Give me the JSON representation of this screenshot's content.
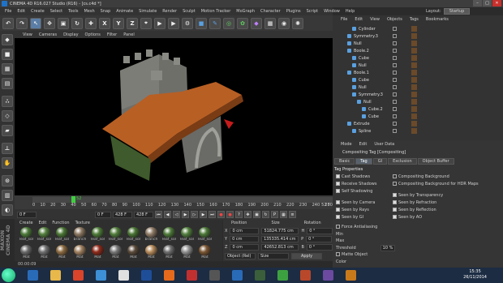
{
  "window": {
    "title": "CINEMA 4D R16.027 Studio (R16) - [cs.c4d *]"
  },
  "menu": [
    "File",
    "Edit",
    "Create",
    "Select",
    "Tools",
    "Mesh",
    "Snap",
    "Animate",
    "Simulate",
    "Render",
    "Sculpt",
    "Motion Tracker",
    "MoGraph",
    "Character",
    "Plugins",
    "Script",
    "Window",
    "Help"
  ],
  "layout": {
    "label": "Layout:",
    "value": "Startup"
  },
  "viewport_menu": [
    "View",
    "Cameras",
    "Display",
    "Options",
    "Filter",
    "Panel"
  ],
  "timeline": {
    "ticks": [
      "0",
      "10",
      "20",
      "30",
      "40",
      "50",
      "60",
      "70",
      "80",
      "90",
      "100",
      "110",
      "120",
      "130",
      "140",
      "150",
      "160",
      "170",
      "180",
      "190",
      "200",
      "210",
      "220",
      "230",
      "240",
      "250"
    ],
    "current_frame": "52",
    "end_label": "52 F"
  },
  "transport": {
    "start": "0 F",
    "current": "0 F",
    "end": "428 F",
    "end2": "428 F"
  },
  "materials": {
    "menu": [
      "Create",
      "Edit",
      "Function",
      "Texture"
    ],
    "items": [
      {
        "name": "leaf_sol",
        "color": "#4d7a3a"
      },
      {
        "name": "leaf_sol",
        "color": "#557f3f"
      },
      {
        "name": "leaf_sol",
        "color": "#4b7635"
      },
      {
        "name": "branch",
        "color": "#8a7660"
      },
      {
        "name": "leaf_sol",
        "color": "#4e7b39"
      },
      {
        "name": "leaf_sol",
        "color": "#527d3c"
      },
      {
        "name": "leaf_sol",
        "color": "#4a7434"
      },
      {
        "name": "branch",
        "color": "#8f7b66"
      },
      {
        "name": "leaf_sol",
        "color": "#4f7a3b"
      },
      {
        "name": "leaf_sol",
        "color": "#527f3e"
      },
      {
        "name": "leaf_sol",
        "color": "#4c7837"
      },
      {
        "name": "Mat",
        "color": "#6a6a6a"
      },
      {
        "name": "Mat",
        "color": "#707070"
      },
      {
        "name": "Mat",
        "color": "#8a6a40"
      },
      {
        "name": "Mat",
        "color": "#a08060"
      },
      {
        "name": "Mat",
        "color": "#8f2a1a"
      },
      {
        "name": "Mat",
        "color": "#777777"
      },
      {
        "name": "Mat",
        "color": "#5a4a3a"
      },
      {
        "name": "Mat",
        "color": "#b58a5a"
      },
      {
        "name": "Mat",
        "color": "#6d6d6d"
      },
      {
        "name": "Mat",
        "color": "#909090"
      },
      {
        "name": "Mat",
        "color": "#7a5533"
      }
    ]
  },
  "coordinates": {
    "headers": [
      "Position",
      "Size",
      "Rotation"
    ],
    "rows": [
      {
        "axis": "X",
        "pos": "0 cm",
        "size": "51824.775 cm",
        "rlabel": "H",
        "rot": "0 °"
      },
      {
        "axis": "Y",
        "pos": "0 cm",
        "size": "135335.414 cm",
        "rlabel": "P",
        "rot": "0 °"
      },
      {
        "axis": "Z",
        "pos": "0 cm",
        "size": "42652.813 cm",
        "rlabel": "B",
        "rot": "0 °"
      }
    ],
    "mode": "Object (Rel)",
    "size_mode": "Size",
    "apply": "Apply"
  },
  "status": "00:00:09",
  "object_manager": {
    "menu": [
      "File",
      "Edit",
      "View",
      "Objects",
      "Tags",
      "Bookmarks"
    ],
    "items": [
      {
        "name": "Cylinder",
        "indent": 2
      },
      {
        "name": "Symmetry.3",
        "indent": 1
      },
      {
        "name": "Null",
        "indent": 1
      },
      {
        "name": "Boole.2",
        "indent": 1
      },
      {
        "name": "Cube",
        "indent": 2
      },
      {
        "name": "Null",
        "indent": 2
      },
      {
        "name": "Boole.1",
        "indent": 1
      },
      {
        "name": "Cube",
        "indent": 2
      },
      {
        "name": "Null",
        "indent": 2
      },
      {
        "name": "Symmetry.3",
        "indent": 2
      },
      {
        "name": "Null",
        "indent": 3
      },
      {
        "name": "Cube.2",
        "indent": 4
      },
      {
        "name": "Cube",
        "indent": 4
      },
      {
        "name": "Extrude",
        "indent": 1
      },
      {
        "name": "Spline",
        "indent": 2
      }
    ]
  },
  "attributes": {
    "menu": [
      "Mode",
      "Edit",
      "User Data"
    ],
    "title": "Compositing Tag [Compositing]",
    "tabs": [
      "Basic",
      "Tag",
      "GI",
      "Exclusion",
      "Object Buffer"
    ],
    "active_tab": "Tag",
    "section": "Tag Properties",
    "left": [
      {
        "label": "Cast Shadows",
        "on": true
      },
      {
        "label": "Receive Shadows",
        "on": true
      },
      {
        "label": "Self Shadowing",
        "on": true
      },
      {
        "label": "Seen by Camera",
        "on": true
      },
      {
        "label": "Seen by Rays",
        "on": true
      },
      {
        "label": "Seen by GI",
        "on": true
      }
    ],
    "right": [
      {
        "label": "Compositing Background",
        "on": false
      },
      {
        "label": "Compositing Background for HDR Maps",
        "on": false
      },
      {
        "label": "Seen by Transparency",
        "on": true
      },
      {
        "label": "Seen by Refraction",
        "on": true
      },
      {
        "label": "Seen by Reflection",
        "on": true
      },
      {
        "label": "Seen by AO",
        "on": true
      }
    ],
    "extra": [
      "Force Antialiasing",
      "Min",
      "Max",
      "Threshold",
      "Matte Object",
      "Color"
    ],
    "threshold": "10 %"
  },
  "taskbar": {
    "time": "15:35",
    "date": "26/11/2014"
  }
}
